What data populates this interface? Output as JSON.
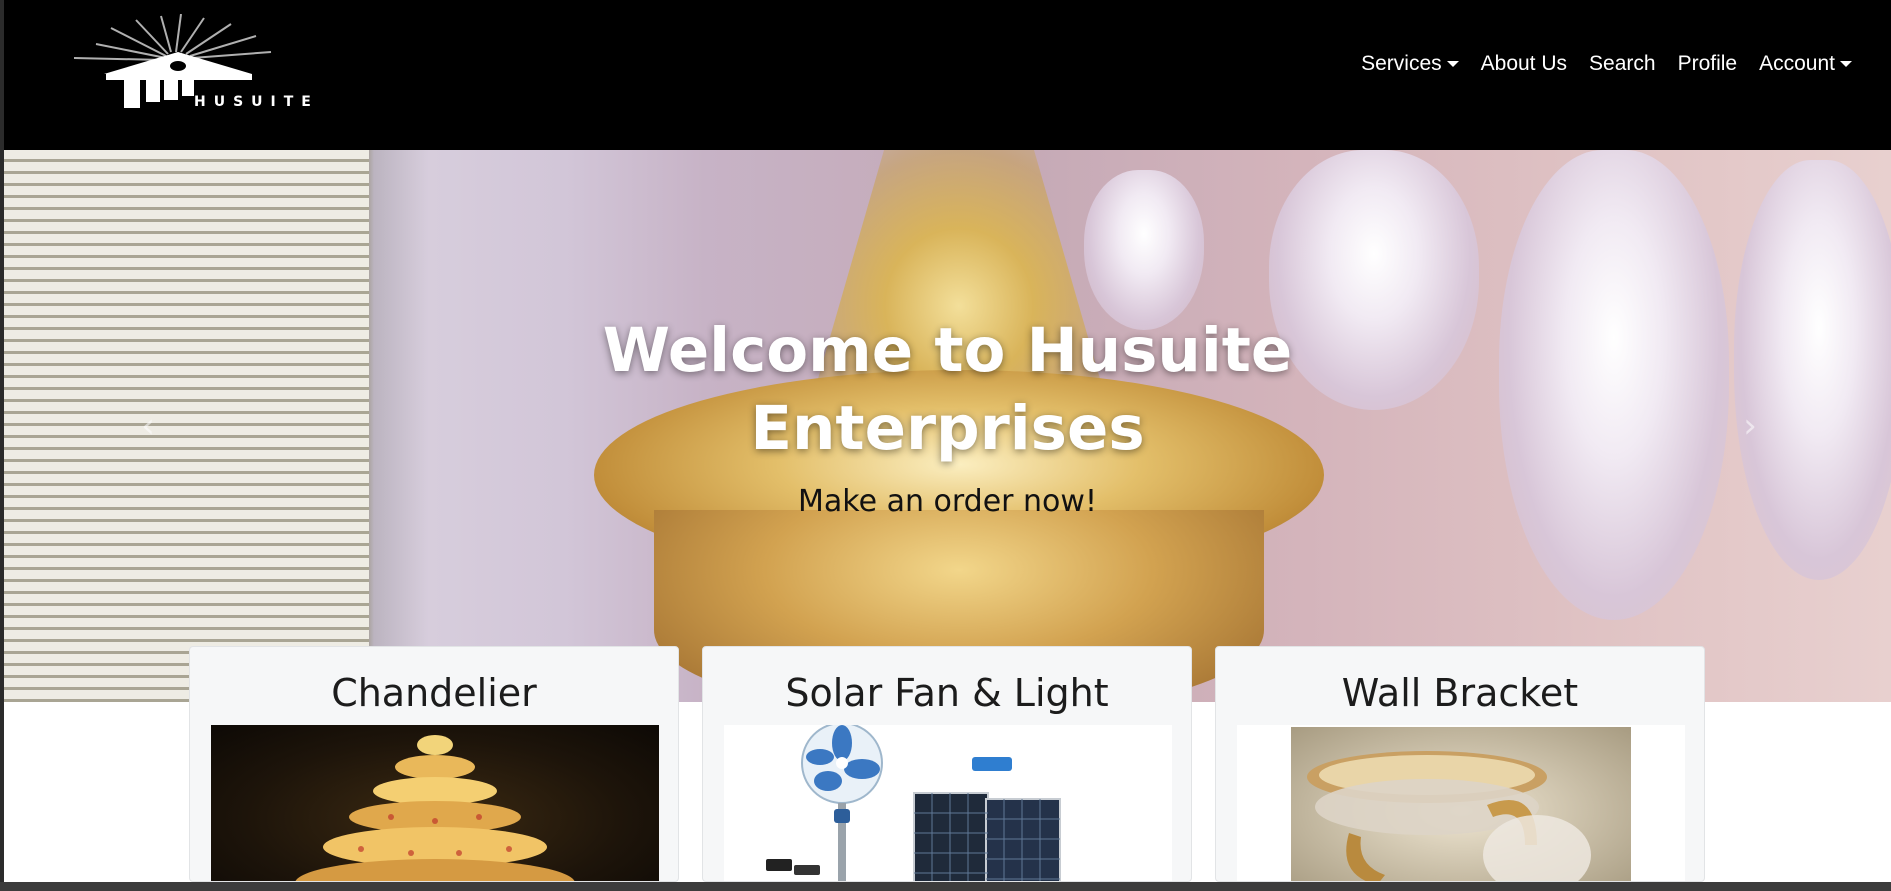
{
  "brand": {
    "logo_text": "HUSUITE"
  },
  "nav": {
    "services_label": "Services",
    "about_label": "About Us",
    "search_label": "Search",
    "profile_label": "Profile",
    "account_label": "Account"
  },
  "hero": {
    "title_line1": "Welcome to Husuite",
    "title_line2": "Enterprises",
    "subtitle": "Make an order now!",
    "prev_icon": "chevron-left-icon",
    "next_icon": "chevron-right-icon",
    "slide_count": 3,
    "active_slide": 1
  },
  "cards": [
    {
      "title": "Chandelier"
    },
    {
      "title": "Solar Fan & Light"
    },
    {
      "title": "Wall Bracket"
    }
  ],
  "colors": {
    "navbar_bg": "#000000",
    "nav_text": "#ffffff",
    "card_bg": "#f6f7f8",
    "caption_title": "#ffffff",
    "caption_sub": "#111111"
  }
}
